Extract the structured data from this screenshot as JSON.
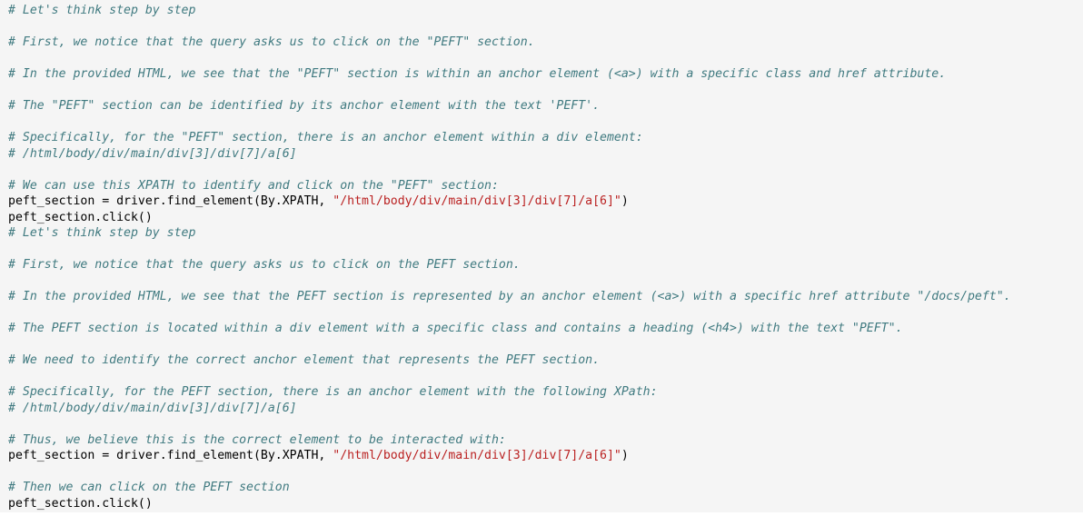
{
  "colors": {
    "panel_background": "#f5f5f5",
    "comment": "#407a80",
    "string": "#ba2121",
    "code": "#000000"
  },
  "code": {
    "lines": [
      {
        "type": "comment",
        "text": "# Let's think step by step"
      },
      {
        "type": "blank"
      },
      {
        "type": "comment",
        "text": "# First, we notice that the query asks us to click on the \"PEFT\" section."
      },
      {
        "type": "blank"
      },
      {
        "type": "comment",
        "text": "# In the provided HTML, we see that the \"PEFT\" section is within an anchor element (<a>) with a specific class and href attribute."
      },
      {
        "type": "blank"
      },
      {
        "type": "comment",
        "text": "# The \"PEFT\" section can be identified by its anchor element with the text 'PEFT'."
      },
      {
        "type": "blank"
      },
      {
        "type": "comment",
        "text": "# Specifically, for the \"PEFT\" section, there is an anchor element within a div element:"
      },
      {
        "type": "comment",
        "text": "# /html/body/div/main/div[3]/div[7]/a[6]"
      },
      {
        "type": "blank"
      },
      {
        "type": "comment",
        "text": "# We can use this XPATH to identify and click on the \"PEFT\" section:"
      },
      {
        "type": "code",
        "before": "peft_section = driver.find_element(By.XPATH, ",
        "string": "\"/html/body/div/main/div[3]/div[7]/a[6]\"",
        "after": ")"
      },
      {
        "type": "code",
        "before": "peft_section.click()",
        "string": "",
        "after": ""
      },
      {
        "type": "comment",
        "text": "# Let's think step by step"
      },
      {
        "type": "blank"
      },
      {
        "type": "comment",
        "text": "# First, we notice that the query asks us to click on the PEFT section."
      },
      {
        "type": "blank"
      },
      {
        "type": "comment",
        "text": "# In the provided HTML, we see that the PEFT section is represented by an anchor element (<a>) with a specific href attribute \"/docs/peft\"."
      },
      {
        "type": "blank"
      },
      {
        "type": "comment",
        "text": "# The PEFT section is located within a div element with a specific class and contains a heading (<h4>) with the text \"PEFT\"."
      },
      {
        "type": "blank"
      },
      {
        "type": "comment",
        "text": "# We need to identify the correct anchor element that represents the PEFT section."
      },
      {
        "type": "blank"
      },
      {
        "type": "comment",
        "text": "# Specifically, for the PEFT section, there is an anchor element with the following XPath:"
      },
      {
        "type": "comment",
        "text": "# /html/body/div/main/div[3]/div[7]/a[6]"
      },
      {
        "type": "blank"
      },
      {
        "type": "comment",
        "text": "# Thus, we believe this is the correct element to be interacted with:"
      },
      {
        "type": "code",
        "before": "peft_section = driver.find_element(By.XPATH, ",
        "string": "\"/html/body/div/main/div[3]/div[7]/a[6]\"",
        "after": ")"
      },
      {
        "type": "blank"
      },
      {
        "type": "comment",
        "text": "# Then we can click on the PEFT section"
      },
      {
        "type": "code",
        "before": "peft_section.click()",
        "string": "",
        "after": ""
      }
    ]
  }
}
